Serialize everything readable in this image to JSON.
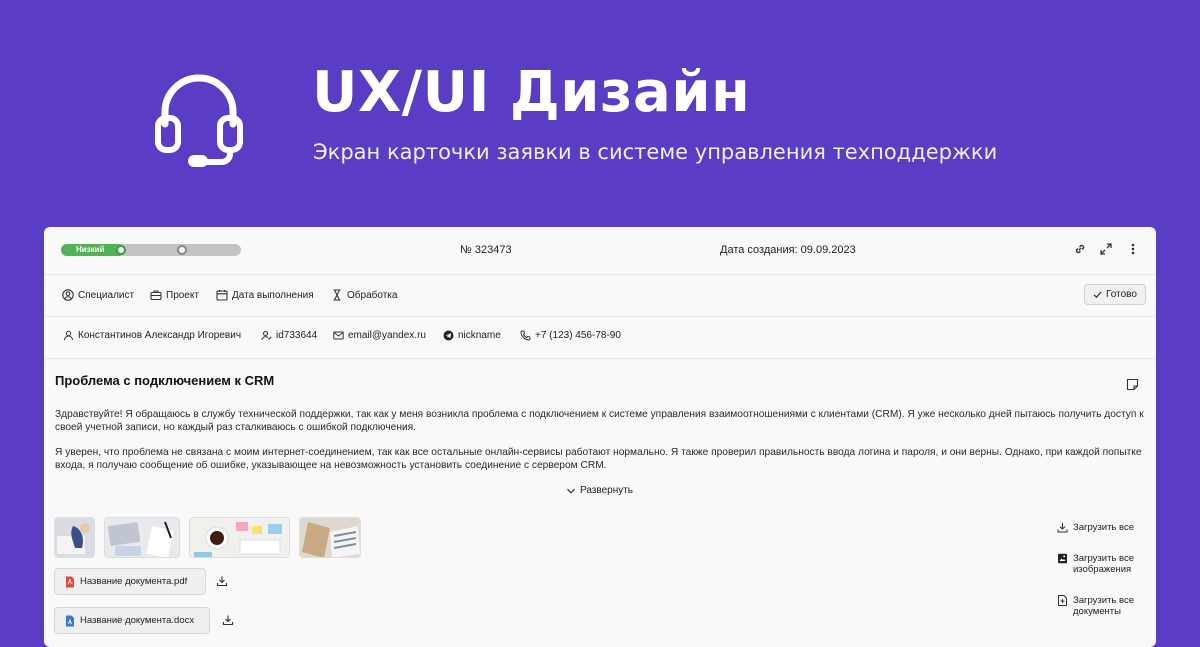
{
  "hero": {
    "icon": "headset-icon",
    "title": "UX/UI  Дизайн",
    "subtitle": "Экран карточки заявки в системе управления техподдержки"
  },
  "colors": {
    "background": "#5b3cc4",
    "card": "#f9f9f9",
    "priority_low": "#52b356",
    "track": "#c4c4c6"
  },
  "ticket": {
    "priority_label": "Низкий",
    "priority_level": 0.35,
    "number": "№ 323473",
    "created": "Дата создания: 09.09.2023",
    "header_icons": [
      "link-icon",
      "expand-icon",
      "more-vertical-icon"
    ]
  },
  "toolbar": {
    "items": [
      {
        "icon": "user-circle-icon",
        "label": "Специалист"
      },
      {
        "icon": "briefcase-icon",
        "label": "Проект"
      },
      {
        "icon": "calendar-icon",
        "label": "Дата выполнения"
      },
      {
        "icon": "hourglass-icon",
        "label": "Обработка"
      }
    ],
    "ready_button": "Готово"
  },
  "contact": {
    "name": "Константинов Александр Игоревич",
    "id": "id733644",
    "email": "email@yandex.ru",
    "telegram": "nickname",
    "phone": "+7 (123) 456-78-90"
  },
  "issue": {
    "title": "Проблема с подключением к CRM",
    "paragraph1": "Здравствуйте! Я обращаюсь в службу технической поддержки, так как у меня возникла проблема с подключением к системе управления взаимоотношениями с клиентами (CRM). Я уже несколько дней пытаюсь получить доступ к своей учетной записи, но каждый раз сталкиваюсь с ошибкой подключения.",
    "paragraph2": "Я уверен, что проблема не связана с моим интернет-соединением, так как все остальные онлайн-сервисы работают нормально. Я также проверил правильность ввода логина и пароля, и они верны. Однако, при каждой попытке входа, я получаю сообщение об ошибке, указывающее на невозможность установить соединение с сервером CRM.",
    "expand": "Развернуть"
  },
  "attachments": {
    "images": [
      "image-1",
      "image-2",
      "image-3",
      "image-4"
    ],
    "files": [
      {
        "name": "Название документа.pdf",
        "icon": "pdf-file-icon"
      },
      {
        "name": "Название документа.docx",
        "icon": "word-file-icon"
      }
    ],
    "download_all": "Загрузить все",
    "download_images": "Загрузить все изображения",
    "download_documents": "Загрузить все документы"
  }
}
